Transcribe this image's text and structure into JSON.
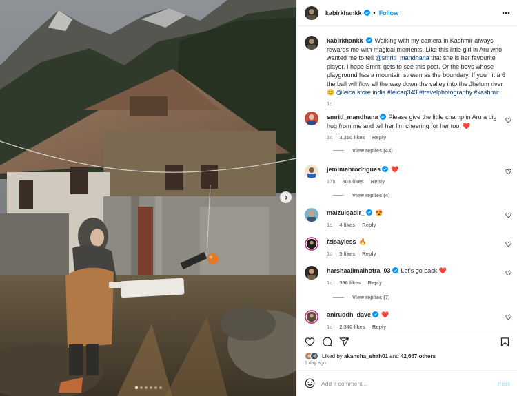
{
  "post": {
    "author": "kabirkhankk",
    "follow_label": "Follow",
    "separator": "•",
    "caption": {
      "text": "Walking with my camera in Kashmir always rewards me with magical moments. Like this little girl in Aru who wanted me to tell ",
      "mention1": "@smriti_mandhana",
      "text2": " that she is her favourite player. I hope Smriti gets to see this post. Or the boys whose playground has a mountain stream as the boundary. If you hit a 6 the ball will flow all the way down the valley into the Jhelum river ",
      "emoji": "😊",
      "mention2": "@leica.store.india",
      "hashtags": "#leicaq343 #travelphotography #kashmir",
      "time": "1d"
    },
    "carousel": {
      "slides": 6,
      "active_index": 0
    }
  },
  "comments": [
    {
      "user": "smriti_mandhana",
      "text": "Please give the little champ in Aru a big hug from me and tell her I'm cheering for her too! ",
      "emoji": "❤️",
      "time": "1d",
      "likes": "3,310 likes",
      "reply": "Reply",
      "view_replies": "View replies (43)"
    },
    {
      "user": "jemimahrodrigues",
      "text": "",
      "emoji": "❤️",
      "time": "17h",
      "likes": "603 likes",
      "reply": "Reply",
      "view_replies": "View replies (4)"
    },
    {
      "user": "maizulqadir_",
      "text": "",
      "emoji": "😍",
      "time": "1d",
      "likes": "4 likes",
      "reply": "Reply"
    },
    {
      "user": "fzlsayless",
      "text": "",
      "emoji": "🔥",
      "time": "1d",
      "likes": "5 likes",
      "reply": "Reply"
    },
    {
      "user": "harshaalimalhotra_03",
      "text": "Let's go back ",
      "emoji": "❤️",
      "time": "1d",
      "likes": "396 likes",
      "reply": "Reply",
      "view_replies": "View replies (7)"
    },
    {
      "user": "aniruddh_dave",
      "text": "",
      "emoji": "❤️",
      "time": "1d",
      "likes": "2,340 likes",
      "reply": "Reply"
    }
  ],
  "footer": {
    "liked_prefix": "Liked by ",
    "liked_user": "akansha_shah01",
    "liked_mid": " and ",
    "liked_count": "42,667 others",
    "time_ago": "1 day ago",
    "comment_placeholder": "Add a comment...",
    "post_label": "Post"
  },
  "icons": {
    "verified": "verified-badge-icon",
    "more": "more-options-icon",
    "heart": "heart-icon",
    "comment": "comment-icon",
    "share": "share-icon",
    "save": "bookmark-icon",
    "emoji": "emoji-icon",
    "next": "chevron-right-icon"
  },
  "colors": {
    "accent": "#0095f6",
    "verified": "#0095f6",
    "post_disabled": "#b2dffc",
    "heart_red": "#ed4956"
  }
}
